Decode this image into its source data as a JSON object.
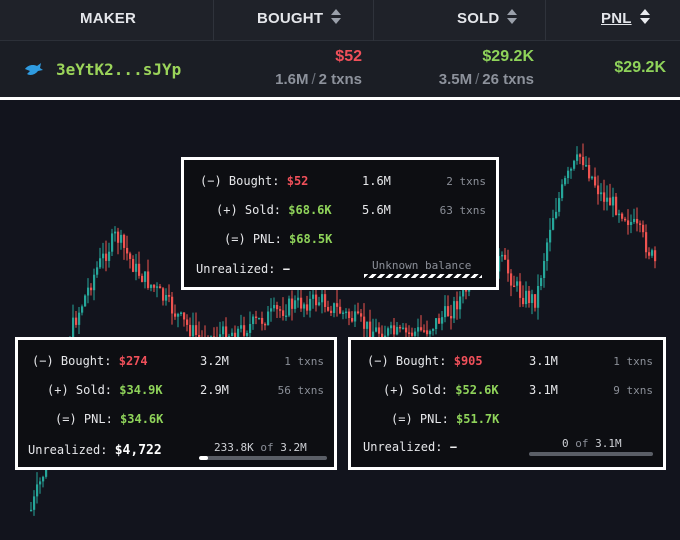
{
  "table": {
    "columns": [
      {
        "label": "MAKER"
      },
      {
        "label": "BOUGHT",
        "sortable": true
      },
      {
        "label": "SOLD",
        "sortable": true
      },
      {
        "label": "PNL",
        "sortable": true,
        "active": true
      }
    ],
    "row": {
      "maker_icon": "fish-icon",
      "maker": "3eYtK2...sJYp",
      "bought_value": "$52",
      "bought_amount": "1.6M",
      "bought_txns": "2 txns",
      "sold_value": "$29.2K",
      "sold_amount": "3.5M",
      "sold_txns": "26 txns",
      "pnl": "$29.2K"
    }
  },
  "tooltips": [
    {
      "bought_label": "(−) Bought:",
      "bought_value": "$52",
      "bought_amount": "1.6M",
      "bought_txns": "2 txns",
      "sold_label": "(+) Sold:",
      "sold_value": "$68.6K",
      "sold_amount": "5.6M",
      "sold_txns": "63 txns",
      "pnl_label": "(=) PNL:",
      "pnl_value": "$68.5K",
      "unrealized_label": "Unrealized:",
      "unrealized_value": "−",
      "balance_text": "Unknown balance"
    },
    {
      "bought_label": "(−) Bought:",
      "bought_value": "$274",
      "bought_amount": "3.2M",
      "bought_txns": "1 txns",
      "sold_label": "(+) Sold:",
      "sold_value": "$34.9K",
      "sold_amount": "2.9M",
      "sold_txns": "56 txns",
      "pnl_label": "(=) PNL:",
      "pnl_value": "$34.6K",
      "unrealized_label": "Unrealized:",
      "unrealized_value": "$4,722",
      "holding": "233.8K",
      "of_word": "of",
      "total": "3.2M",
      "progress": 0.073
    },
    {
      "bought_label": "(−) Bought:",
      "bought_value": "$905",
      "bought_amount": "3.1M",
      "bought_txns": "1 txns",
      "sold_label": "(+) Sold:",
      "sold_value": "$52.6K",
      "sold_amount": "3.1M",
      "sold_txns": "9 txns",
      "pnl_label": "(=) PNL:",
      "pnl_value": "$51.7K",
      "unrealized_label": "Unrealized:",
      "unrealized_value": "−",
      "holding": "0",
      "of_word": "of",
      "total": "3.1M",
      "progress": 0
    }
  ],
  "colors": {
    "up": "#26a69a",
    "down": "#ef5350",
    "pnl_green": "#8fd35a",
    "loss_red": "#f0505a",
    "background": "#12141d"
  }
}
